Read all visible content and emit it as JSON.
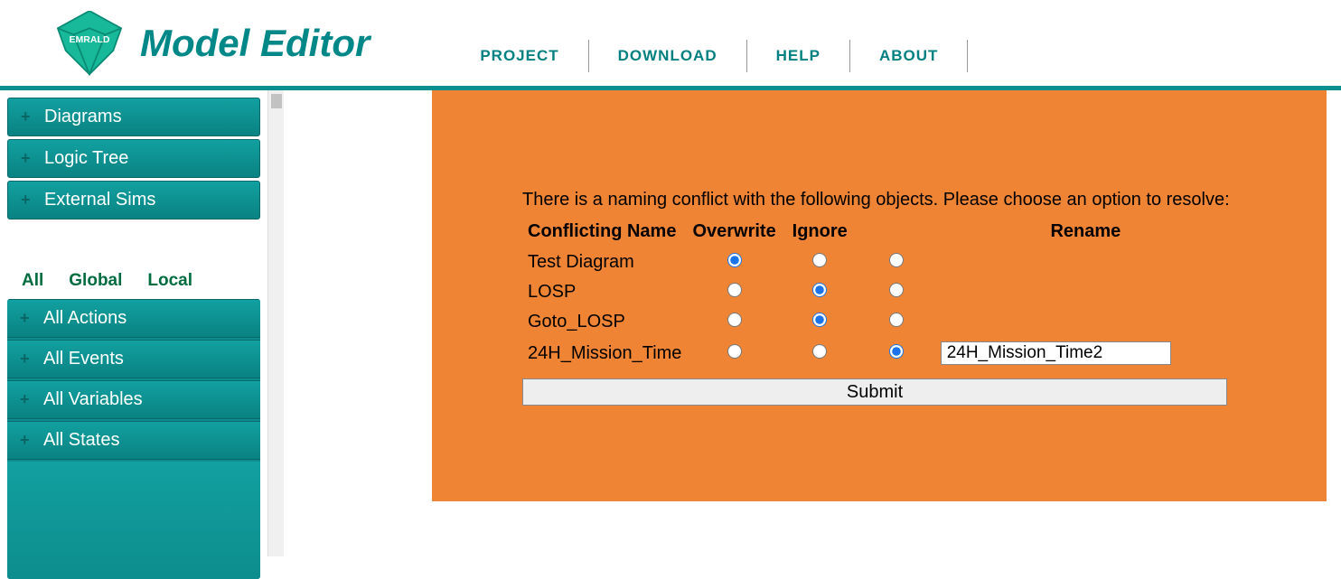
{
  "header": {
    "title": "Model Editor",
    "nav": [
      "PROJECT",
      "DOWNLOAD",
      "HELP",
      "ABOUT"
    ]
  },
  "sidebar": {
    "top": [
      {
        "label": "Diagrams"
      },
      {
        "label": "Logic Tree"
      },
      {
        "label": "External Sims"
      }
    ],
    "tabs": [
      "All",
      "Global",
      "Local"
    ],
    "active_tab": 1,
    "bottom": [
      {
        "label": "All Actions"
      },
      {
        "label": "All Events"
      },
      {
        "label": "All Variables"
      },
      {
        "label": "All States"
      }
    ]
  },
  "dialog": {
    "message": "There is a naming conflict with the following objects. Please choose an option to resolve:",
    "columns": {
      "name": "Conflicting Name",
      "overwrite": "Overwrite",
      "ignore": "Ignore",
      "rename": "Rename"
    },
    "rows": [
      {
        "name": "Test Diagram",
        "selected": "overwrite",
        "rename_value": ""
      },
      {
        "name": "LOSP",
        "selected": "ignore",
        "rename_value": ""
      },
      {
        "name": "Goto_LOSP",
        "selected": "ignore",
        "rename_value": ""
      },
      {
        "name": "24H_Mission_Time",
        "selected": "rename",
        "rename_value": "24H_Mission_Time2"
      }
    ],
    "submit_label": "Submit"
  }
}
